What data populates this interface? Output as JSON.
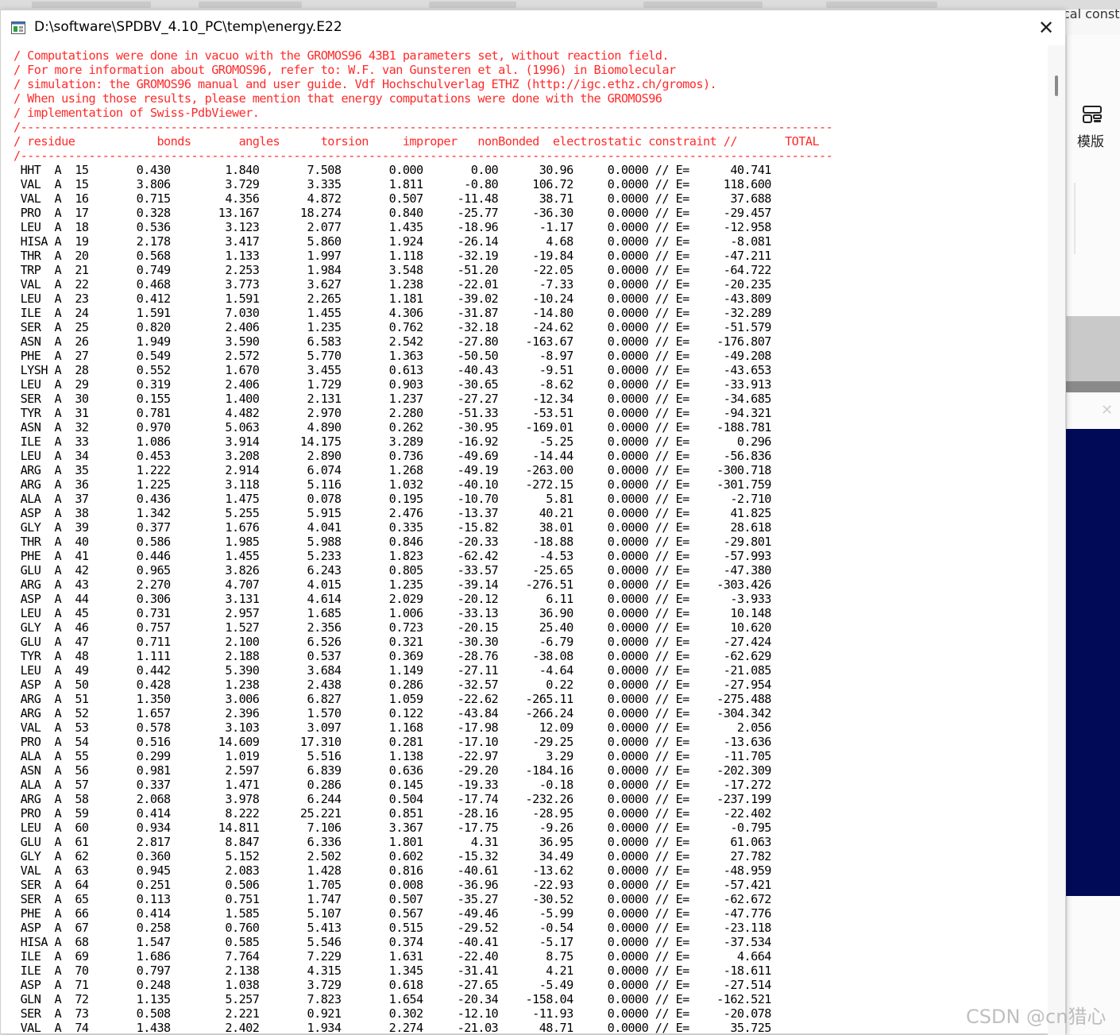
{
  "background": {
    "right_app_title": "cal const",
    "template_label": "模版"
  },
  "window": {
    "title": "D:\\software\\SPDBV_4.10_PC\\temp\\energy.E22",
    "close_label": "✕"
  },
  "header_lines": [
    "/ Computations were done in vacuo with the GROMOS96 43B1 parameters set, without reaction field.",
    "/ For more information about GROMOS96, refer to: W.F. van Gunsteren et al. (1996) in Biomolecular",
    "/ simulation: the GROMOS96 manual and user guide. Vdf Hochschulverlag ETHZ (http://igc.ethz.ch/gromos).",
    "/ When using those results, please mention that energy computations were done with the GROMOS96",
    "/ implementation of Swiss-PdbViewer.",
    "/-----------------------------------------------------------------------------------------------------------------------",
    "/ residue            bonds       angles      torsion     improper   nonBonded  electrostatic constraint //       TOTAL",
    "/-----------------------------------------------------------------------------------------------------------------------"
  ],
  "rows": [
    "HHT  A  15",
    "VAL  A  15",
    "VAL  A  16",
    "PRO  A  17",
    "LEU  A  18",
    "HISA A  19",
    "THR  A  20",
    "TRP  A  21",
    "VAL  A  22",
    "LEU  A  23",
    "ILE  A  24",
    "SER  A  25",
    "ASN  A  26",
    "PHE  A  27",
    "LYSH A  28",
    "LEU  A  29",
    "SER  A  30",
    "TYR  A  31",
    "ASN  A  32",
    "ILE  A  33",
    "LEU  A  34",
    "ARG  A  35",
    "ARG  A  36",
    "ALA  A  37",
    "ASP  A  38",
    "GLY  A  39",
    "THR  A  40",
    "PHE  A  41",
    "GLU  A  42",
    "ARG  A  43",
    "ASP  A  44",
    "LEU  A  45",
    "GLY  A  46",
    "GLU  A  47",
    "TYR  A  48",
    "LEU  A  49",
    "ASP  A  50",
    "ARG  A  51",
    "ARG  A  52",
    "VAL  A  53",
    "PRO  A  54",
    "ALA  A  55",
    "ASN  A  56",
    "ALA  A  57",
    "ARG  A  58",
    "PRO  A  59",
    "LEU  A  60",
    "GLU  A  61",
    "GLY  A  62",
    "VAL  A  63",
    "SER  A  64",
    "SER  A  65",
    "PHE  A  66",
    "ASP  A  67",
    "HISA A  68",
    "ILE  A  69",
    "ILE  A  70",
    "ASP  A  71",
    "GLN  A  72",
    "SER  A  73",
    "VAL  A  74"
  ],
  "values": [
    [
      "0.430",
      "1.840",
      "7.508",
      "0.000",
      "0.00",
      "30.96",
      "0.0000",
      "40.741"
    ],
    [
      "3.806",
      "3.729",
      "3.335",
      "1.811",
      "-0.80",
      "106.72",
      "0.0000",
      "118.600"
    ],
    [
      "0.715",
      "4.356",
      "4.872",
      "0.507",
      "-11.48",
      "38.71",
      "0.0000",
      "37.688"
    ],
    [
      "0.328",
      "13.167",
      "18.274",
      "0.840",
      "-25.77",
      "-36.30",
      "0.0000",
      "-29.457"
    ],
    [
      "0.536",
      "3.123",
      "2.077",
      "1.435",
      "-18.96",
      "-1.17",
      "0.0000",
      "-12.958"
    ],
    [
      "2.178",
      "3.417",
      "5.860",
      "1.924",
      "-26.14",
      "4.68",
      "0.0000",
      "-8.081"
    ],
    [
      "0.568",
      "1.133",
      "1.997",
      "1.118",
      "-32.19",
      "-19.84",
      "0.0000",
      "-47.211"
    ],
    [
      "0.749",
      "2.253",
      "1.984",
      "3.548",
      "-51.20",
      "-22.05",
      "0.0000",
      "-64.722"
    ],
    [
      "0.468",
      "3.773",
      "3.627",
      "1.238",
      "-22.01",
      "-7.33",
      "0.0000",
      "-20.235"
    ],
    [
      "0.412",
      "1.591",
      "2.265",
      "1.181",
      "-39.02",
      "-10.24",
      "0.0000",
      "-43.809"
    ],
    [
      "1.591",
      "7.030",
      "1.455",
      "4.306",
      "-31.87",
      "-14.80",
      "0.0000",
      "-32.289"
    ],
    [
      "0.820",
      "2.406",
      "1.235",
      "0.762",
      "-32.18",
      "-24.62",
      "0.0000",
      "-51.579"
    ],
    [
      "1.949",
      "3.590",
      "6.583",
      "2.542",
      "-27.80",
      "-163.67",
      "0.0000",
      "-176.807"
    ],
    [
      "0.549",
      "2.572",
      "5.770",
      "1.363",
      "-50.50",
      "-8.97",
      "0.0000",
      "-49.208"
    ],
    [
      "0.552",
      "1.670",
      "3.455",
      "0.613",
      "-40.43",
      "-9.51",
      "0.0000",
      "-43.653"
    ],
    [
      "0.319",
      "2.406",
      "1.729",
      "0.903",
      "-30.65",
      "-8.62",
      "0.0000",
      "-33.913"
    ],
    [
      "0.155",
      "1.400",
      "2.131",
      "1.237",
      "-27.27",
      "-12.34",
      "0.0000",
      "-34.685"
    ],
    [
      "0.781",
      "4.482",
      "2.970",
      "2.280",
      "-51.33",
      "-53.51",
      "0.0000",
      "-94.321"
    ],
    [
      "0.970",
      "5.063",
      "4.890",
      "0.262",
      "-30.95",
      "-169.01",
      "0.0000",
      "-188.781"
    ],
    [
      "1.086",
      "3.914",
      "14.175",
      "3.289",
      "-16.92",
      "-5.25",
      "0.0000",
      "0.296"
    ],
    [
      "0.453",
      "3.208",
      "2.890",
      "0.736",
      "-49.69",
      "-14.44",
      "0.0000",
      "-56.836"
    ],
    [
      "1.222",
      "2.914",
      "6.074",
      "1.268",
      "-49.19",
      "-263.00",
      "0.0000",
      "-300.718"
    ],
    [
      "1.225",
      "3.118",
      "5.116",
      "1.032",
      "-40.10",
      "-272.15",
      "0.0000",
      "-301.759"
    ],
    [
      "0.436",
      "1.475",
      "0.078",
      "0.195",
      "-10.70",
      "5.81",
      "0.0000",
      "-2.710"
    ],
    [
      "1.342",
      "5.255",
      "5.915",
      "2.476",
      "-13.37",
      "40.21",
      "0.0000",
      "41.825"
    ],
    [
      "0.377",
      "1.676",
      "4.041",
      "0.335",
      "-15.82",
      "38.01",
      "0.0000",
      "28.618"
    ],
    [
      "0.586",
      "1.985",
      "5.988",
      "0.846",
      "-20.33",
      "-18.88",
      "0.0000",
      "-29.801"
    ],
    [
      "0.446",
      "1.455",
      "5.233",
      "1.823",
      "-62.42",
      "-4.53",
      "0.0000",
      "-57.993"
    ],
    [
      "0.965",
      "3.826",
      "6.243",
      "0.805",
      "-33.57",
      "-25.65",
      "0.0000",
      "-47.380"
    ],
    [
      "2.270",
      "4.707",
      "4.015",
      "1.235",
      "-39.14",
      "-276.51",
      "0.0000",
      "-303.426"
    ],
    [
      "0.306",
      "3.131",
      "4.614",
      "2.029",
      "-20.12",
      "6.11",
      "0.0000",
      "-3.933"
    ],
    [
      "0.731",
      "2.957",
      "1.685",
      "1.006",
      "-33.13",
      "36.90",
      "0.0000",
      "10.148"
    ],
    [
      "0.757",
      "1.527",
      "2.356",
      "0.723",
      "-20.15",
      "25.40",
      "0.0000",
      "10.620"
    ],
    [
      "0.711",
      "2.100",
      "6.526",
      "0.321",
      "-30.30",
      "-6.79",
      "0.0000",
      "-27.424"
    ],
    [
      "1.111",
      "2.188",
      "0.537",
      "0.369",
      "-28.76",
      "-38.08",
      "0.0000",
      "-62.629"
    ],
    [
      "0.442",
      "5.390",
      "3.684",
      "1.149",
      "-27.11",
      "-4.64",
      "0.0000",
      "-21.085"
    ],
    [
      "0.428",
      "1.238",
      "2.438",
      "0.286",
      "-32.57",
      "0.22",
      "0.0000",
      "-27.954"
    ],
    [
      "1.350",
      "3.006",
      "6.827",
      "1.059",
      "-22.62",
      "-265.11",
      "0.0000",
      "-275.488"
    ],
    [
      "1.657",
      "2.396",
      "1.570",
      "0.122",
      "-43.84",
      "-266.24",
      "0.0000",
      "-304.342"
    ],
    [
      "0.578",
      "3.103",
      "3.097",
      "1.168",
      "-17.98",
      "12.09",
      "0.0000",
      "2.056"
    ],
    [
      "0.516",
      "14.609",
      "17.310",
      "0.281",
      "-17.10",
      "-29.25",
      "0.0000",
      "-13.636"
    ],
    [
      "0.299",
      "1.019",
      "5.516",
      "1.138",
      "-22.97",
      "3.29",
      "0.0000",
      "-11.705"
    ],
    [
      "0.981",
      "2.597",
      "6.839",
      "0.636",
      "-29.20",
      "-184.16",
      "0.0000",
      "-202.309"
    ],
    [
      "0.337",
      "1.471",
      "0.286",
      "0.145",
      "-19.33",
      "-0.18",
      "0.0000",
      "-17.272"
    ],
    [
      "2.068",
      "3.978",
      "6.244",
      "0.504",
      "-17.74",
      "-232.26",
      "0.0000",
      "-237.199"
    ],
    [
      "0.414",
      "8.222",
      "25.221",
      "0.851",
      "-28.16",
      "-28.95",
      "0.0000",
      "-22.402"
    ],
    [
      "0.934",
      "14.811",
      "7.106",
      "3.367",
      "-17.75",
      "-9.26",
      "0.0000",
      "-0.795"
    ],
    [
      "2.817",
      "8.847",
      "6.336",
      "1.801",
      "4.31",
      "36.95",
      "0.0000",
      "61.063"
    ],
    [
      "0.360",
      "5.152",
      "2.502",
      "0.602",
      "-15.32",
      "34.49",
      "0.0000",
      "27.782"
    ],
    [
      "0.945",
      "2.083",
      "1.428",
      "0.816",
      "-40.61",
      "-13.62",
      "0.0000",
      "-48.959"
    ],
    [
      "0.251",
      "0.506",
      "1.705",
      "0.008",
      "-36.96",
      "-22.93",
      "0.0000",
      "-57.421"
    ],
    [
      "0.113",
      "0.751",
      "1.747",
      "0.507",
      "-35.27",
      "-30.52",
      "0.0000",
      "-62.672"
    ],
    [
      "0.414",
      "1.585",
      "5.107",
      "0.567",
      "-49.46",
      "-5.99",
      "0.0000",
      "-47.776"
    ],
    [
      "0.258",
      "0.760",
      "5.413",
      "0.515",
      "-29.52",
      "-0.54",
      "0.0000",
      "-23.118"
    ],
    [
      "1.547",
      "0.585",
      "5.546",
      "0.374",
      "-40.41",
      "-5.17",
      "0.0000",
      "-37.534"
    ],
    [
      "1.686",
      "7.764",
      "7.229",
      "1.631",
      "-22.40",
      "8.75",
      "0.0000",
      "4.664"
    ],
    [
      "0.797",
      "2.138",
      "4.315",
      "1.345",
      "-31.41",
      "4.21",
      "0.0000",
      "-18.611"
    ],
    [
      "0.248",
      "1.038",
      "3.729",
      "0.618",
      "-27.65",
      "-5.49",
      "0.0000",
      "-27.514"
    ],
    [
      "1.135",
      "5.257",
      "7.823",
      "1.654",
      "-20.34",
      "-158.04",
      "0.0000",
      "-162.521"
    ],
    [
      "0.508",
      "2.221",
      "0.921",
      "0.302",
      "-12.10",
      "-11.93",
      "0.0000",
      "-20.078"
    ],
    [
      "1.438",
      "2.402",
      "1.934",
      "2.274",
      "-21.03",
      "48.71",
      "0.0000",
      "35.725"
    ]
  ],
  "row_separator": "// E=",
  "watermark": "CSDN @cn猎心"
}
